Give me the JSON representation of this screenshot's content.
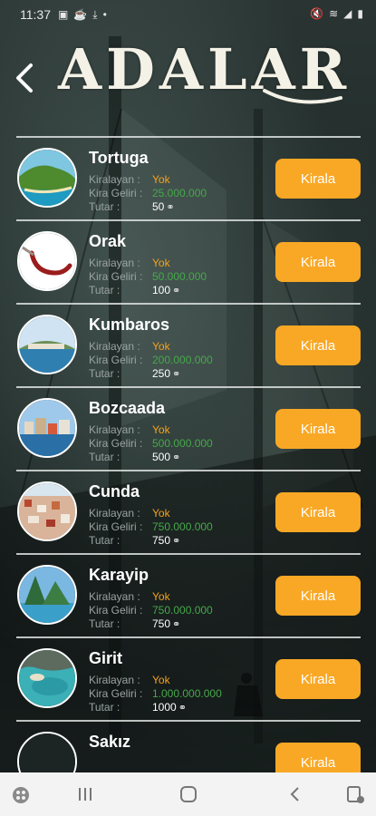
{
  "status_bar": {
    "time": "11:37"
  },
  "header": {
    "title": "ADALAR"
  },
  "labels": {
    "renter": "Kiralayan :",
    "income": "Kira Geliri :",
    "amount": "Tutar :"
  },
  "islands": [
    {
      "name": "Tortuga",
      "renter": "Yok",
      "income": "25.000.000",
      "amount": "50",
      "button": "Kirala"
    },
    {
      "name": "Orak",
      "renter": "Yok",
      "income": "50.000.000",
      "amount": "100",
      "button": "Kirala"
    },
    {
      "name": "Kumbaros",
      "renter": "Yok",
      "income": "200.000.000",
      "amount": "250",
      "button": "Kirala"
    },
    {
      "name": "Bozcaada",
      "renter": "Yok",
      "income": "500.000.000",
      "amount": "500",
      "button": "Kirala"
    },
    {
      "name": "Cunda",
      "renter": "Yok",
      "income": "750.000.000",
      "amount": "750",
      "button": "Kirala"
    },
    {
      "name": "Karayip",
      "renter": "Yok",
      "income": "750.000.000",
      "amount": "750",
      "button": "Kirala"
    },
    {
      "name": "Girit",
      "renter": "Yok",
      "income": "1.000.000.000",
      "amount": "1000",
      "button": "Kirala"
    },
    {
      "name": "Sakız",
      "renter": "",
      "income": "",
      "amount": "",
      "button": "Kirala"
    }
  ],
  "colors": {
    "accent": "#f9a825",
    "renter_value": "#f5a21b",
    "income_value": "#46a84b"
  },
  "icons": {
    "back": "chevron-left-icon",
    "currency": "coin-icon",
    "nav": [
      "apps-icon",
      "recents-icon",
      "home-icon",
      "back-icon",
      "keyboard-icon"
    ]
  }
}
